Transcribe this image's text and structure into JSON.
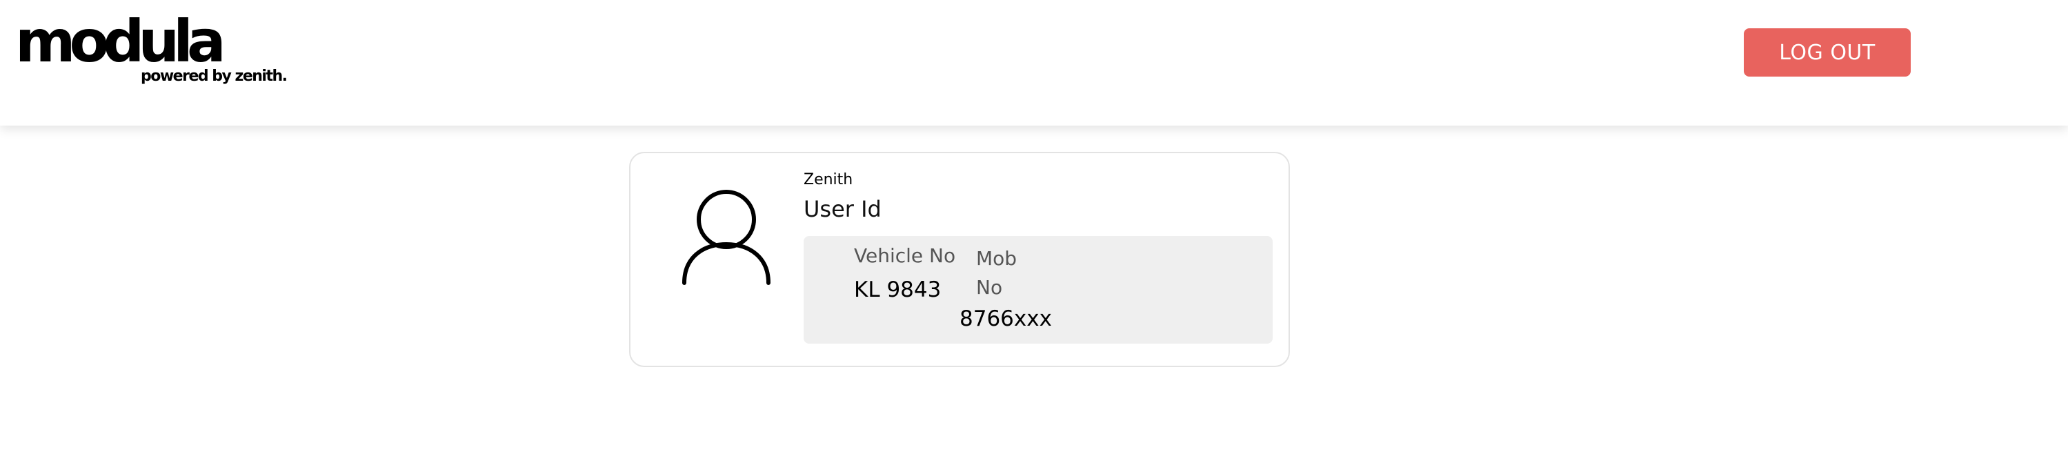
{
  "header": {
    "logo_text": "modula",
    "logo_tagline": "powered by zenith.",
    "logout_label": "LOG OUT"
  },
  "profile": {
    "org_name": "Zenith",
    "user_id_label": "User Id",
    "vehicle_label": "Vehicle No",
    "vehicle_value": "KL 9843",
    "mobile_label": "Mob No",
    "mobile_value": "8766xxx",
    "avatar_icon": "user-icon"
  },
  "colors": {
    "logout_button": "#e8635e",
    "details_background": "#efefef",
    "card_border": "#e3e3e3"
  }
}
